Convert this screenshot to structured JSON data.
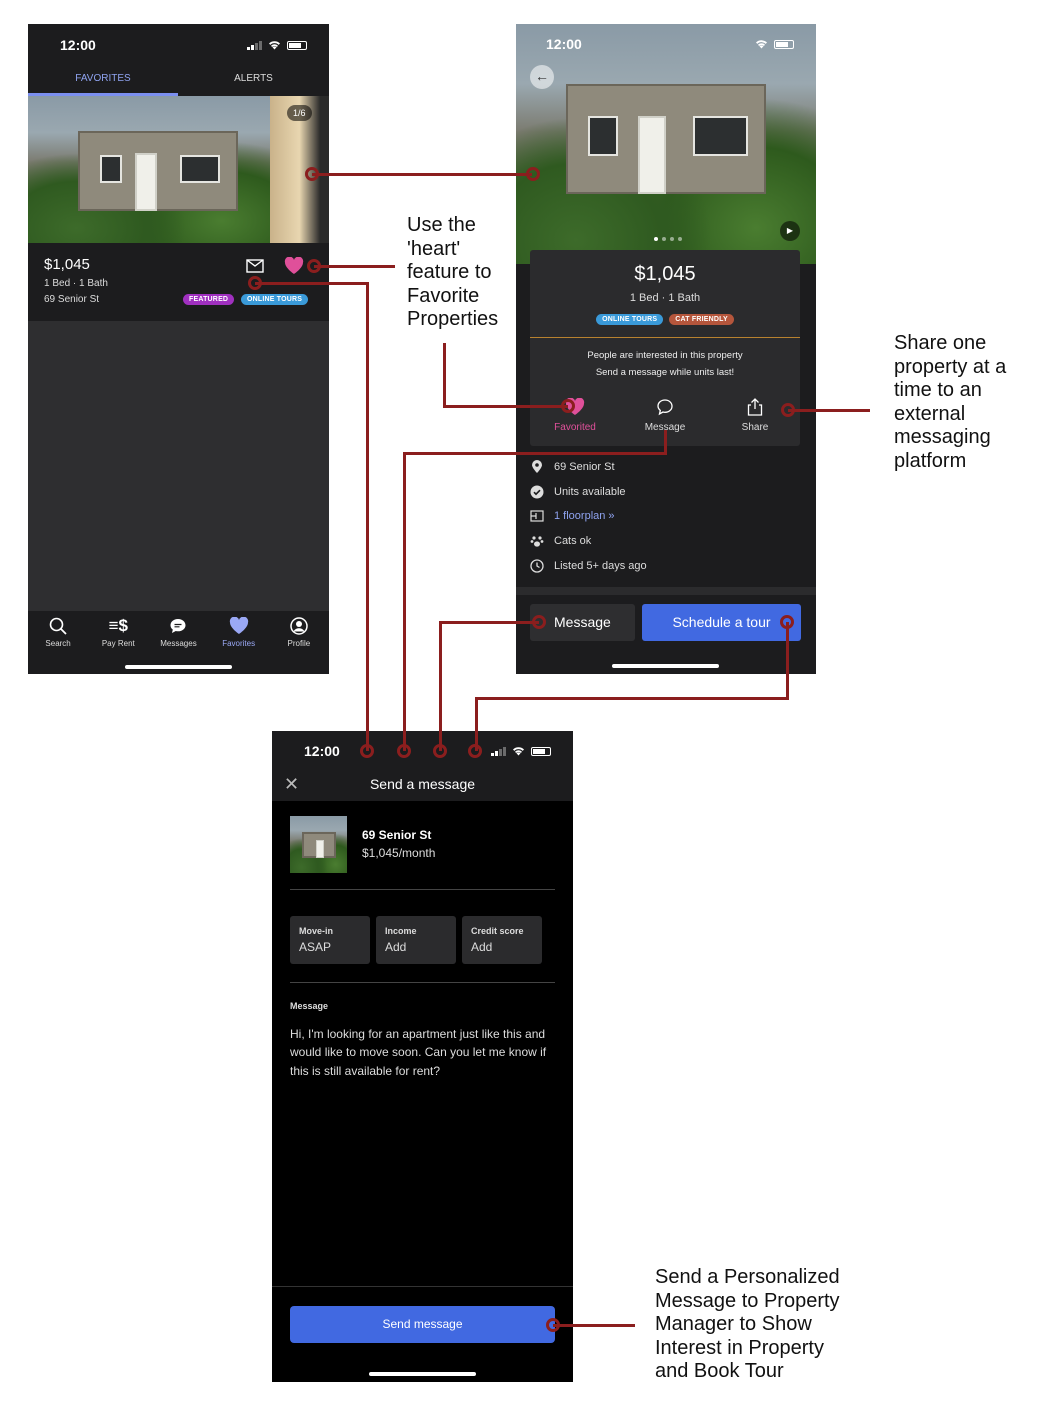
{
  "screen1": {
    "status_time": "12:00",
    "tabs": [
      "FAVORITES",
      "ALERTS"
    ],
    "photo_counter": "1/6",
    "price": "$1,045",
    "beds_baths": "1 Bed · 1 Bath",
    "address": "69 Senior St",
    "badges": [
      "FEATURED",
      "ONLINE TOURS"
    ],
    "nav": [
      "Search",
      "Pay Rent",
      "Messages",
      "Favorites",
      "Profile"
    ]
  },
  "screen2": {
    "status_time": "12:00",
    "price": "$1,045",
    "beds_baths": "1 Bed · 1 Bath",
    "badges": [
      "ONLINE TOURS",
      "CAT FRIENDLY"
    ],
    "interest_line1": "People are interested in this property",
    "interest_line2": "Send a message while units last!",
    "actions": [
      "Favorited",
      "Message",
      "Share"
    ],
    "info": [
      "69 Senior St",
      "Units available",
      "1 floorplan »",
      "Cats ok",
      "Listed 5+ days ago"
    ],
    "message_button": "Message",
    "tour_button": "Schedule a tour"
  },
  "screen3": {
    "status_time": "12:00",
    "title": "Send a message",
    "property_address": "69 Senior St",
    "property_price": "$1,045/month",
    "fields": [
      {
        "label": "Move-in",
        "value": "ASAP"
      },
      {
        "label": "Income",
        "value": "Add"
      },
      {
        "label": "Credit score",
        "value": "Add"
      }
    ],
    "message_label": "Message",
    "message_text": "Hi, I'm looking for an apartment just like this and would like to move soon. Can you let me know if this is still available for rent?",
    "send_button": "Send message"
  },
  "annotations": {
    "heart": "Use the 'heart' feature to Favorite Properties",
    "share": "Share one property at a time to an external messaging platform",
    "send": "Send a Personalized Message to Property Manager to Show Interest in Property and Book Tour"
  },
  "colors": {
    "accent_blue": "#4169e1",
    "heart_pink": "#e0509a",
    "connector_red": "#8b1e1e",
    "featured_purple": "#a030c0",
    "online_tours_blue": "#3a9ad9",
    "cat_friendly_orange": "#b5563c"
  }
}
